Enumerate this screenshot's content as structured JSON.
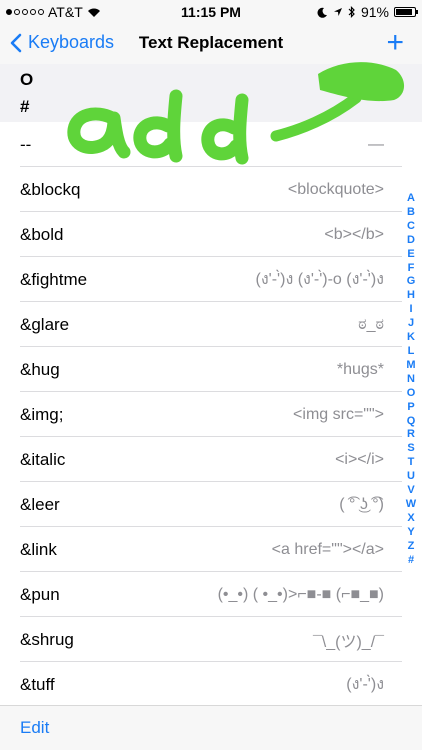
{
  "status": {
    "carrier": "AT&T",
    "time": "11:15 PM",
    "battery": "91%",
    "battery_level": 0.91
  },
  "nav": {
    "back_label": "Keyboards",
    "title": "Text Replacement",
    "add_symbol": "+"
  },
  "sections": {
    "o": "O",
    "hash": "#"
  },
  "rows": [
    {
      "phrase": "--",
      "shortcut": "—"
    },
    {
      "phrase": "&blockq",
      "shortcut": "<blockquote>"
    },
    {
      "phrase": "&bold",
      "shortcut": "<b></b>"
    },
    {
      "phrase": "&fightme",
      "shortcut": "(ง'-'̀)ง (ง'-'̀)-o (ง'-'̀)ง"
    },
    {
      "phrase": "&glare",
      "shortcut": "ಠ_ಠ"
    },
    {
      "phrase": "&hug",
      "shortcut": "*hugs*"
    },
    {
      "phrase": "&img;",
      "shortcut": "<img src=\"\">"
    },
    {
      "phrase": "&italic",
      "shortcut": "<i></i>"
    },
    {
      "phrase": "&leer",
      "shortcut": "( ͡° ͜ʖ ͡°)"
    },
    {
      "phrase": "&link",
      "shortcut": "<a href=\"\"></a>"
    },
    {
      "phrase": "&pun",
      "shortcut": "(•_•) ( •_•)>⌐■-■ (⌐■_■)"
    },
    {
      "phrase": "&shrug",
      "shortcut": "¯\\_(ツ)_/¯"
    },
    {
      "phrase": "&tuff",
      "shortcut": "(ง'-'̀)ง"
    }
  ],
  "index_letters": [
    "A",
    "B",
    "C",
    "D",
    "E",
    "F",
    "G",
    "H",
    "I",
    "J",
    "K",
    "L",
    "M",
    "N",
    "O",
    "P",
    "Q",
    "R",
    "S",
    "T",
    "U",
    "V",
    "W",
    "X",
    "Y",
    "Z",
    "#"
  ],
  "annotation": {
    "text": "add",
    "color": "#5fd43a"
  },
  "toolbar": {
    "edit_label": "Edit"
  },
  "colors": {
    "accent": "#1a7cf5",
    "secondary_text": "#8e8e93"
  }
}
